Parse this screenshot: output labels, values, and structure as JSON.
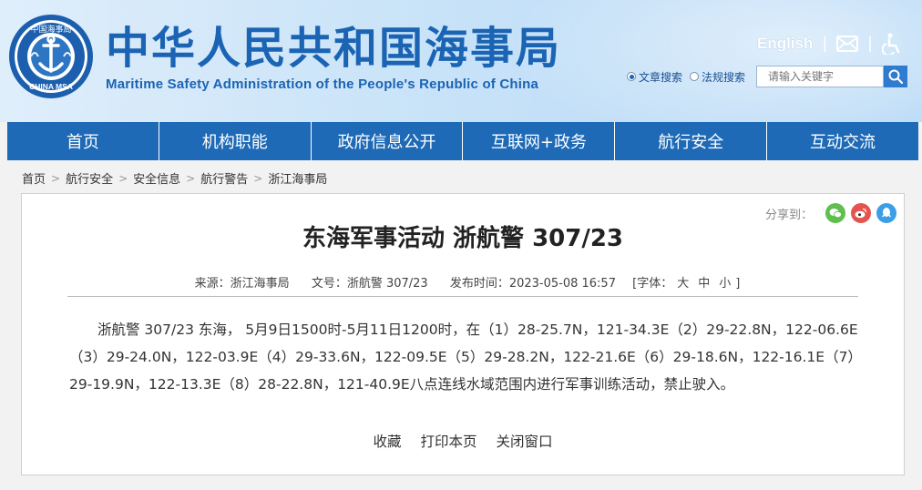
{
  "header": {
    "logo_text": "中国海事局",
    "logo_bottom": "CHINA MSA",
    "title": "中华人民共和国海事局",
    "subtitle": "Maritime Safety Administration of the People's Republic of China",
    "english_link": "English",
    "separator": "|"
  },
  "search": {
    "options": [
      "文章搜索",
      "法规搜索"
    ],
    "selected": "文章搜索",
    "placeholder": "请输入关键字"
  },
  "nav": {
    "items": [
      "首页",
      "机构职能",
      "政府信息公开",
      "互联网+政务",
      "航行安全",
      "互动交流"
    ]
  },
  "breadcrumb": {
    "items": [
      "首页",
      "航行安全",
      "安全信息",
      "航行警告",
      "浙江海事局"
    ],
    "separator": ">"
  },
  "article": {
    "share_label": "分享到：",
    "title": "东海军事活动 浙航警 307/23",
    "source": "来源：浙江海事局",
    "doc_no": "文号：浙航警 307/23",
    "publish_time": "发布时间：2023-05-08 16:57",
    "font_label": "[字体：",
    "font_large": "大",
    "font_medium": "中",
    "font_small": "小",
    "font_close": "]",
    "body": "浙航警 307/23 东海， 5月9日1500时-5月11日1200时，在（1）28-25.7N，121-34.3E（2）29-22.8N，122-06.6E（3）29-24.0N，122-03.9E（4）29-33.6N，122-09.5E（5）29-28.2N，122-21.6E（6）29-18.6N，122-16.1E（7）29-19.9N，122-13.3E（8）28-22.8N，121-40.9E八点连线水域范围内进行军事训练活动，禁止驶入。",
    "actions": [
      "收藏",
      "打印本页",
      "关闭窗口"
    ]
  },
  "colors": {
    "brand_blue": "#1b64b4",
    "nav_blue": "#1e6ab6",
    "wechat_green": "#5fbf4d",
    "weibo_red": "#e6534e",
    "qq_blue": "#3d9ee8"
  }
}
